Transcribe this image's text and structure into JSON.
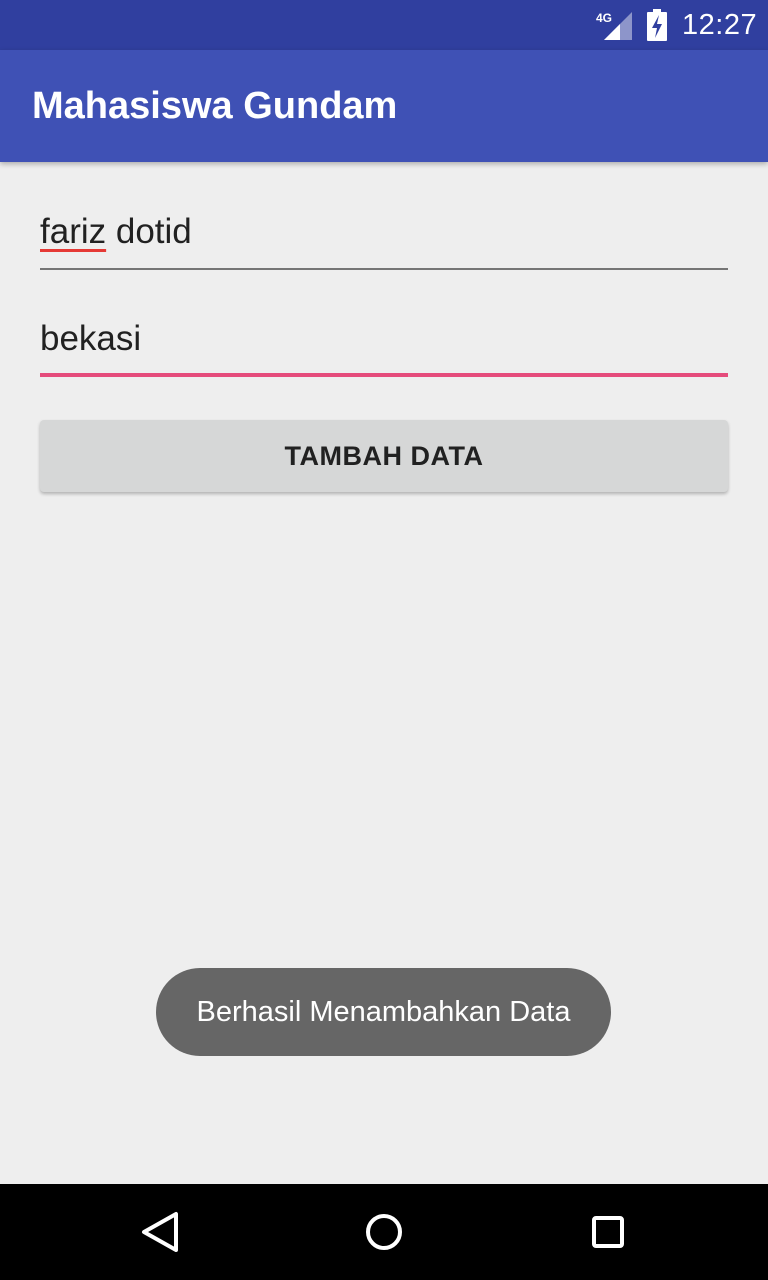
{
  "status_bar": {
    "network_label": "4G",
    "time": "12:27",
    "icons": [
      "signal-4g-icon",
      "battery-charging-icon"
    ]
  },
  "app_bar": {
    "title": "Mahasiswa Gundam"
  },
  "form": {
    "name_field": {
      "value_misspelled": "fariz",
      "value_rest": " dotid"
    },
    "address_field": {
      "value": "bekasi",
      "focused": true
    },
    "add_button_label": "TAMBAH DATA"
  },
  "toast": {
    "message": "Berhasil Menambahkan Data"
  },
  "nav_bar": {
    "icons": [
      "back-icon",
      "home-icon",
      "recents-icon"
    ]
  },
  "colors": {
    "status_bar": "#303f9f",
    "app_bar": "#3f51b5",
    "accent": "#e54b7b",
    "background": "#eeeeee",
    "button": "#d6d7d7",
    "toast": "#666666"
  }
}
